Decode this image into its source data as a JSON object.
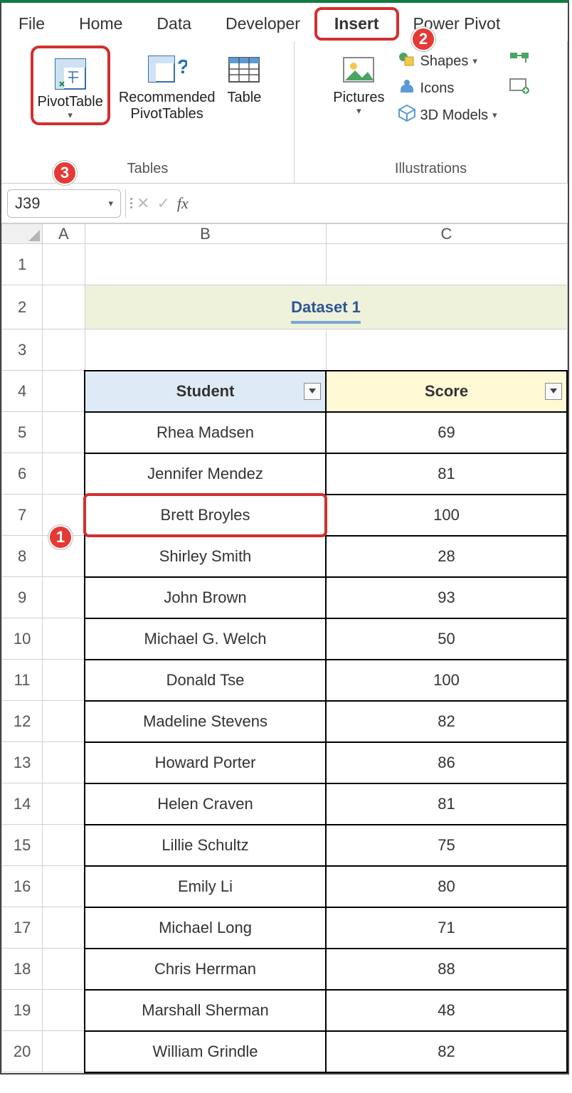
{
  "ribbon": {
    "tabs": [
      "File",
      "Home",
      "Data",
      "Developer",
      "Insert",
      "Power Pivot"
    ],
    "active_tab": "Insert",
    "groups": {
      "tables": {
        "label": "Tables",
        "pivot": "PivotTable",
        "recommended": "Recommended\nPivotTables",
        "table": "Table"
      },
      "illustrations": {
        "label": "Illustrations",
        "pictures": "Pictures",
        "shapes": "Shapes",
        "icons": "Icons",
        "models": "3D Models"
      }
    }
  },
  "callouts": {
    "c1": "1",
    "c2": "2",
    "c3": "3"
  },
  "namebox": {
    "value": "J39"
  },
  "columns": [
    "A",
    "B",
    "C"
  ],
  "title": "Dataset 1",
  "headers": {
    "student": "Student",
    "score": "Score"
  },
  "rows": [
    {
      "n": "1"
    },
    {
      "n": "2",
      "title": true
    },
    {
      "n": "3"
    },
    {
      "n": "4",
      "header": true
    },
    {
      "n": "5",
      "student": "Rhea Madsen",
      "score": "69"
    },
    {
      "n": "6",
      "student": "Jennifer Mendez",
      "score": "81"
    },
    {
      "n": "7",
      "student": "Brett Broyles",
      "score": "100",
      "highlight": true
    },
    {
      "n": "8",
      "student": "Shirley Smith",
      "score": "28"
    },
    {
      "n": "9",
      "student": "John Brown",
      "score": "93"
    },
    {
      "n": "10",
      "student": "Michael G. Welch",
      "score": "50"
    },
    {
      "n": "11",
      "student": "Donald Tse",
      "score": "100"
    },
    {
      "n": "12",
      "student": "Madeline Stevens",
      "score": "82"
    },
    {
      "n": "13",
      "student": "Howard Porter",
      "score": "86"
    },
    {
      "n": "14",
      "student": "Helen Craven",
      "score": "81"
    },
    {
      "n": "15",
      "student": "Lillie Schultz",
      "score": "75"
    },
    {
      "n": "16",
      "student": "Emily Li",
      "score": "80"
    },
    {
      "n": "17",
      "student": "Michael Long",
      "score": "71"
    },
    {
      "n": "18",
      "student": "Chris Herrman",
      "score": "88"
    },
    {
      "n": "19",
      "student": "Marshall Sherman",
      "score": "48"
    },
    {
      "n": "20",
      "student": "William Grindle",
      "score": "82"
    }
  ]
}
